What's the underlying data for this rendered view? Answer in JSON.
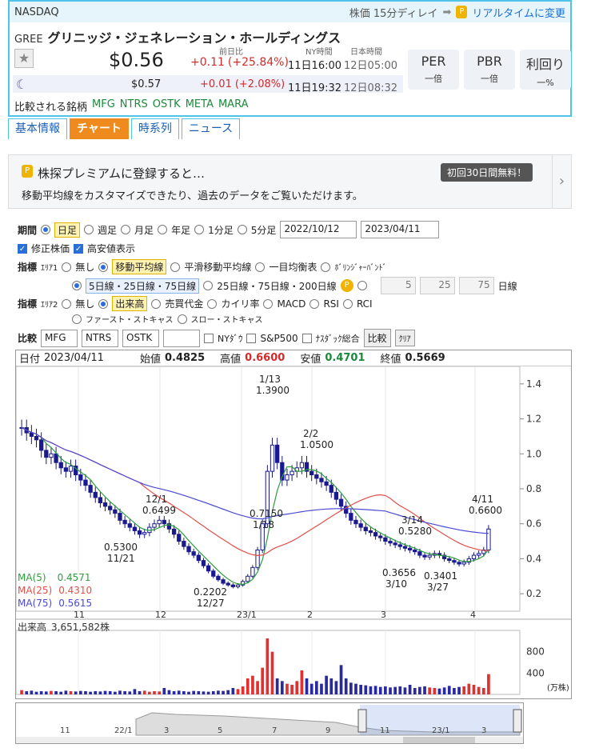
{
  "market": "NASDAQ",
  "delay_note": "株価 15分ディレイ",
  "realtime_link": "リアルタイムに変更",
  "ticker": "GREE",
  "company": "グリニッジ・ジェネレーション・ホールディングス",
  "labels": {
    "prev_diff": "前日比",
    "ny_time": "NY時間",
    "jp_time": "日本時間"
  },
  "price": {
    "value": "$0.56",
    "change": "+0.11",
    "pct": "(+25.84%)",
    "ny": "11日16:00",
    "jp": "12日05:00"
  },
  "after": {
    "value": "$0.57",
    "change": "+0.01",
    "pct": "(+2.08%)",
    "ny": "11日19:32",
    "jp": "12日08:32"
  },
  "ratios": [
    {
      "label": "PER",
      "value": "一倍"
    },
    {
      "label": "PBR",
      "value": "一倍"
    },
    {
      "label": "利回り",
      "value": "一%"
    }
  ],
  "compare_label": "比較される銘柄",
  "compare": [
    "MFG",
    "NTRS",
    "OSTK",
    "META",
    "MARA"
  ],
  "tabs": [
    "基本情報",
    "チャート",
    "時系列",
    "ニュース"
  ],
  "promo": {
    "title": "株探プレミアムに登録すると…",
    "badge": "初回30日間無料！",
    "desc": "移動平均線をカスタマイズできたり、過去のデータをご覧いただけます。"
  },
  "controls": {
    "period_label": "期間",
    "periods": [
      "日足",
      "週足",
      "月足",
      "年足",
      "1分足",
      "5分足"
    ],
    "date_from": "2022/10/12",
    "date_to": "2023/04/11",
    "adjusted": "修正株価",
    "highlow": "高安値表示",
    "ind_label": "指標",
    "area1": "ｴﾘｱ1",
    "area1_opts": [
      "無し",
      "移動平均線",
      "平滑移動平均線",
      "一目均衡表",
      "ﾎﾞﾘﾝｼﾞｬｰﾊﾞﾝﾄﾞ"
    ],
    "ma_opts": [
      "5日線・25日線・75日線",
      "25日線・75日線・200日線"
    ],
    "ma_vals": [
      "5",
      "25",
      "75"
    ],
    "ma_unit": "日線",
    "area2": "ｴﾘｱ2",
    "area2_opts": [
      "無し",
      "出来高",
      "売買代金",
      "カイリ率",
      "MACD",
      "RSI",
      "RCI",
      "ファースト・ストキャス",
      "スロー・ストキャス"
    ],
    "cmp_label": "比較",
    "cmp_vals": [
      "MFG",
      "NTRS",
      "OSTK",
      ""
    ],
    "cmp_idx": [
      "NYﾀﾞｳ",
      "S&P500",
      "ﾅｽﾀﾞｯｸ総合"
    ],
    "cmp_btn": "比較",
    "clr_btn": "ｸﾘｱ"
  },
  "ohlc": {
    "date_label": "日付",
    "date": "2023/04/11",
    "open_label": "始値",
    "open": "0.4825",
    "high_label": "高値",
    "high": "0.6600",
    "low_label": "安値",
    "low": "0.4701",
    "close_label": "終値",
    "close": "0.5669"
  },
  "ma_legend": [
    {
      "name": "MA(5)",
      "value": "0.4571",
      "color": "#2e9e3e"
    },
    {
      "name": "MA(25)",
      "value": "0.4310",
      "color": "#e0504a"
    },
    {
      "name": "MA(75)",
      "value": "0.5615",
      "color": "#4a4ad6"
    }
  ],
  "volume_label": "出来高",
  "volume_value": "3,651,582株",
  "volume_unit": "(万株)",
  "nav_ticks": [
    "11",
    "22/1",
    "3",
    "5",
    "7",
    "9",
    "11",
    "23/1",
    "3"
  ],
  "chart_data": {
    "type": "candlestick",
    "y_ticks": [
      "1.4",
      "1.2",
      "1.0",
      "0.8",
      "0.6",
      "0.4",
      "0.2"
    ],
    "ylim": [
      0.1,
      1.5
    ],
    "x_ticks": [
      "11",
      "12",
      "23/1",
      "2",
      "3",
      "4"
    ],
    "vol_ticks": [
      "800",
      "400"
    ],
    "annotations": [
      {
        "date": "1/13",
        "value": "1.3900"
      },
      {
        "date": "2/2",
        "value": "1.0500"
      },
      {
        "date": "12/1",
        "value": "0.6499"
      },
      {
        "date": "11/21",
        "value": "0.5300"
      },
      {
        "date": "1/18",
        "value": "0.7150"
      },
      {
        "date": "3/14",
        "value": "0.5280"
      },
      {
        "date": "4/11",
        "value": "0.6600"
      },
      {
        "date": "12/27",
        "value": "0.2202"
      },
      {
        "date": "3/10",
        "value": "0.3656"
      },
      {
        "date": "3/27",
        "value": "0.3401"
      }
    ],
    "closes": [
      1.15,
      1.12,
      1.1,
      1.08,
      1.02,
      0.98,
      1.0,
      0.95,
      0.92,
      0.9,
      0.93,
      0.88,
      0.85,
      0.82,
      0.78,
      0.75,
      0.72,
      0.7,
      0.68,
      0.66,
      0.62,
      0.6,
      0.58,
      0.56,
      0.54,
      0.55,
      0.58,
      0.6,
      0.62,
      0.6,
      0.57,
      0.54,
      0.5,
      0.47,
      0.44,
      0.42,
      0.39,
      0.36,
      0.33,
      0.3,
      0.28,
      0.26,
      0.25,
      0.24,
      0.25,
      0.27,
      0.3,
      0.35,
      0.45,
      0.6,
      0.9,
      1.05,
      0.95,
      0.85,
      0.88,
      0.9,
      0.92,
      0.95,
      0.9,
      0.88,
      0.86,
      0.84,
      0.82,
      0.78,
      0.74,
      0.7,
      0.66,
      0.62,
      0.6,
      0.58,
      0.56,
      0.55,
      0.53,
      0.52,
      0.5,
      0.49,
      0.48,
      0.47,
      0.46,
      0.45,
      0.44,
      0.42,
      0.41,
      0.42,
      0.43,
      0.42,
      0.4,
      0.39,
      0.38,
      0.37,
      0.38,
      0.4,
      0.42,
      0.43,
      0.45,
      0.57
    ],
    "volumes": [
      80,
      60,
      70,
      50,
      60,
      55,
      65,
      60,
      50,
      70,
      60,
      55,
      65,
      60,
      50,
      60,
      55,
      65,
      60,
      50,
      70,
      60,
      55,
      100,
      60,
      70,
      50,
      60,
      55,
      120,
      80,
      60,
      70,
      60,
      50,
      65,
      60,
      55,
      50,
      60,
      70,
      65,
      80,
      120,
      100,
      150,
      300,
      350,
      250,
      500,
      1050,
      800,
      300,
      250,
      200,
      180,
      250,
      450,
      300,
      200,
      250,
      200,
      350,
      300,
      250,
      550,
      300,
      220,
      200,
      180,
      170,
      150,
      160,
      140,
      150,
      130,
      140,
      150,
      130,
      180,
      120,
      140,
      150,
      130,
      120,
      110,
      130,
      160,
      120,
      140,
      150,
      200,
      180,
      140,
      120,
      380
    ]
  }
}
